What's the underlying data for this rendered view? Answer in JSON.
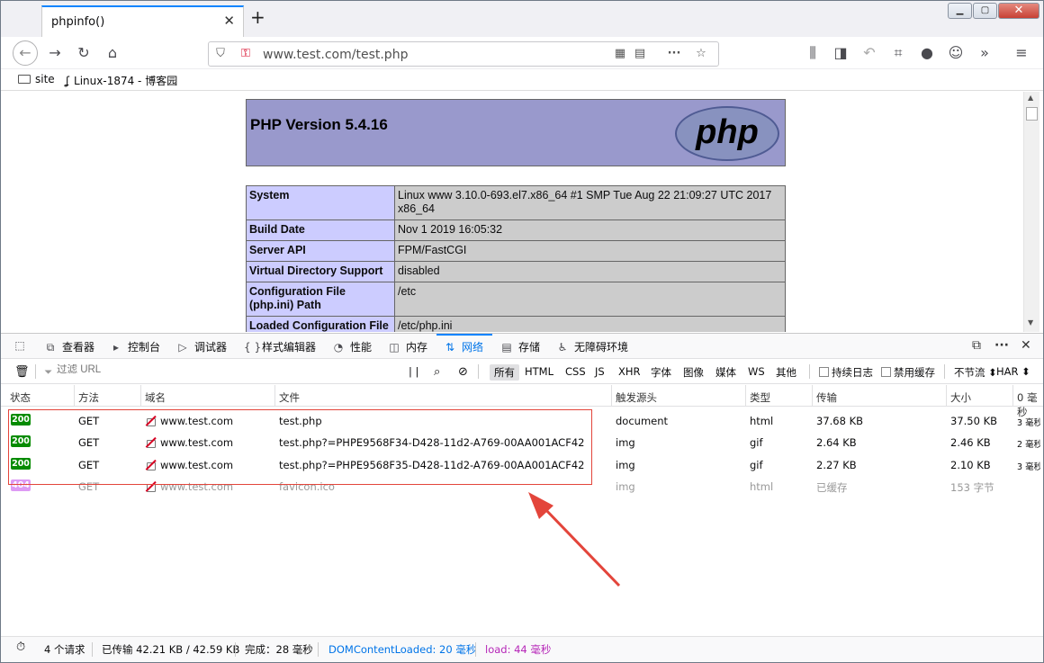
{
  "browser": {
    "tab_title": "phpinfo()",
    "url": "www.test.com/test.php",
    "bookmarks": [
      "site",
      "Linux-1874 - 博客园"
    ]
  },
  "php": {
    "version_title": "PHP Version 5.4.16",
    "logo_text": "php",
    "rows": [
      {
        "key": "System",
        "value": "Linux www 3.10.0-693.el7.x86_64 #1 SMP Tue Aug 22 21:09:27 UTC 2017 x86_64"
      },
      {
        "key": "Build Date",
        "value": "Nov 1 2019 16:05:32"
      },
      {
        "key": "Server API",
        "value": "FPM/FastCGI"
      },
      {
        "key": "Virtual Directory Support",
        "value": "disabled"
      },
      {
        "key": "Configuration File (php.ini) Path",
        "value": "/etc"
      },
      {
        "key": "Loaded Configuration File",
        "value": "/etc/php.ini"
      }
    ]
  },
  "devtools": {
    "tabs": [
      {
        "icon": "⧉",
        "label": "查看器"
      },
      {
        "icon": "▸",
        "label": "控制台"
      },
      {
        "icon": "▷",
        "label": "调试器"
      },
      {
        "icon": "{ }",
        "label": "样式编辑器"
      },
      {
        "icon": "◔",
        "label": "性能"
      },
      {
        "icon": "◫",
        "label": "内存"
      },
      {
        "icon": "⇅",
        "label": "网络"
      },
      {
        "icon": "▤",
        "label": "存储"
      },
      {
        "icon": "♿",
        "label": "无障碍环境"
      }
    ],
    "filter_placeholder": "过滤 URL",
    "type_filters": [
      "所有",
      "HTML",
      "CSS",
      "JS",
      "XHR",
      "字体",
      "图像",
      "媒体",
      "WS",
      "其他"
    ],
    "persist_logs": "持续日志",
    "disable_cache": "禁用缓存",
    "throttle": "不节流 ⬍",
    "har": "HAR ⬍",
    "columns": [
      "状态",
      "方法",
      "域名",
      "文件",
      "触发源头",
      "类型",
      "传输",
      "大小",
      "0 毫秒"
    ],
    "requests": [
      {
        "status": "200",
        "method": "GET",
        "domain": "www.test.com",
        "file": "test.php",
        "cause": "document",
        "type": "html",
        "transferred": "37.68 KB",
        "size": "37.50 KB",
        "time": "3 毫秒"
      },
      {
        "status": "200",
        "method": "GET",
        "domain": "www.test.com",
        "file": "test.php?=PHPE9568F34-D428-11d2-A769-00AA001ACF42",
        "cause": "img",
        "type": "gif",
        "transferred": "2.64 KB",
        "size": "2.46 KB",
        "time": "2 毫秒"
      },
      {
        "status": "200",
        "method": "GET",
        "domain": "www.test.com",
        "file": "test.php?=PHPE9568F35-D428-11d2-A769-00AA001ACF42",
        "cause": "img",
        "type": "gif",
        "transferred": "2.27 KB",
        "size": "2.10 KB",
        "time": "3 毫秒"
      },
      {
        "status": "404",
        "method": "GET",
        "domain": "www.test.com",
        "file": "favicon.ico",
        "cause": "img",
        "type": "html",
        "transferred": "已缓存",
        "size": "153 字节",
        "time": ""
      }
    ],
    "summary": {
      "requests": "4 个请求",
      "transferred": "已传输 42.21 KB / 42.59 KB",
      "finish": "完成：28 毫秒",
      "dcl": "DOMContentLoaded: 20 毫秒",
      "load": "load: 44 毫秒"
    },
    "colors": {
      "dcl": "#0074e8",
      "load": "#b627b8",
      "status_ok": "#058b00",
      "annotation": "#e3453b"
    }
  }
}
